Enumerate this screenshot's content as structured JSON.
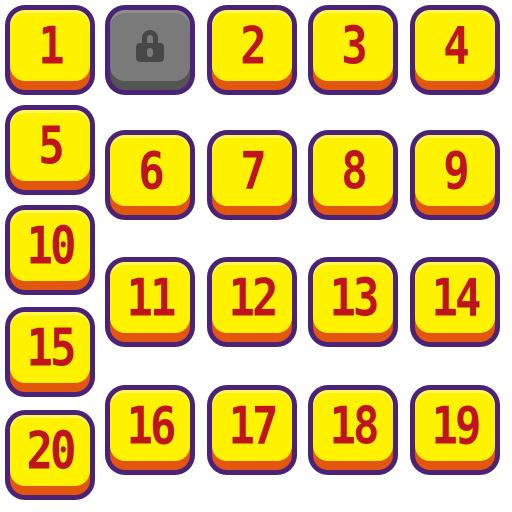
{
  "levels": [
    {
      "id": "level-1",
      "label": "1",
      "locked": false
    },
    {
      "id": "level-locked",
      "label": "",
      "locked": true,
      "icon": "lock-icon"
    },
    {
      "id": "level-2",
      "label": "2",
      "locked": false
    },
    {
      "id": "level-3",
      "label": "3",
      "locked": false
    },
    {
      "id": "level-4",
      "label": "4",
      "locked": false
    },
    {
      "id": "level-5",
      "label": "5",
      "locked": false
    },
    {
      "id": "level-6",
      "label": "6",
      "locked": false
    },
    {
      "id": "level-7",
      "label": "7",
      "locked": false
    },
    {
      "id": "level-8",
      "label": "8",
      "locked": false
    },
    {
      "id": "level-9",
      "label": "9",
      "locked": false
    },
    {
      "id": "level-10",
      "label": "10",
      "locked": false
    },
    {
      "id": "level-11",
      "label": "11",
      "locked": false
    },
    {
      "id": "level-12",
      "label": "12",
      "locked": false
    },
    {
      "id": "level-13",
      "label": "13",
      "locked": false
    },
    {
      "id": "level-14",
      "label": "14",
      "locked": false
    },
    {
      "id": "level-15",
      "label": "15",
      "locked": false
    },
    {
      "id": "level-16",
      "label": "16",
      "locked": false
    },
    {
      "id": "level-17",
      "label": "17",
      "locked": false
    },
    {
      "id": "level-18",
      "label": "18",
      "locked": false
    },
    {
      "id": "level-19",
      "label": "19",
      "locked": false
    },
    {
      "id": "level-20",
      "label": "20",
      "locked": false
    }
  ],
  "colors": {
    "tile_face": "#fff200",
    "tile_shadow": "#e2560e",
    "tile_border": "#4a2378",
    "number": "#c0141c",
    "locked_face": "#7a7a7a",
    "lock_icon": "#474747"
  }
}
